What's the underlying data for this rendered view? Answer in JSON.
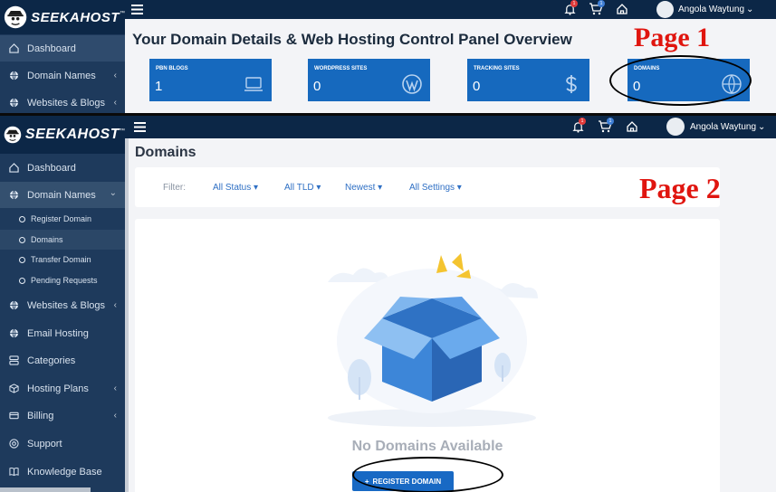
{
  "brand": {
    "name": "SEEKAHOST",
    "tm": "™"
  },
  "page1": {
    "annotation": "Page 1",
    "title": "Your Domain Details & Web Hosting Control Panel Overview",
    "sidebar": [
      {
        "label": "Dashboard",
        "icon": "dashboard-icon"
      },
      {
        "label": "Domain Names",
        "icon": "globe-icon",
        "arrow": "‹"
      },
      {
        "label": "Websites & Blogs",
        "icon": "globe-icon",
        "arrow": "‹"
      }
    ],
    "topbar": {
      "notif_count": "1",
      "cart_count": "1",
      "user": "Angola Waytung",
      "caret": "⌄"
    },
    "stats": [
      {
        "label": "PBN BLOGS",
        "value": "1",
        "icon": "laptop-icon"
      },
      {
        "label": "WORDPRESS SITES",
        "value": "0",
        "icon": "wordpress-icon"
      },
      {
        "label": "TRACKING SITES",
        "value": "0",
        "icon": "dollar-icon"
      },
      {
        "label": "DOMAINS",
        "value": "0",
        "icon": "globe-icon"
      }
    ]
  },
  "page2": {
    "annotation": "Page 2",
    "page_title": "Domains",
    "topbar": {
      "notif_count": "1",
      "cart_count": "1",
      "user": "Angola Waytung",
      "caret": "⌄"
    },
    "sidebar": {
      "dashboard": "Dashboard",
      "domain_names": "Domain Names",
      "domain_names_arrow": "⌄",
      "sub": [
        "Register Domain",
        "Domains",
        "Transfer Domain",
        "Pending Requests"
      ],
      "websites": "Websites & Blogs",
      "email": "Email Hosting",
      "categories": "Categories",
      "hosting": "Hosting Plans",
      "billing": "Billing",
      "support": "Support",
      "kb": "Knowledge Base",
      "arrow": "‹"
    },
    "filter": {
      "label": "Filter:",
      "status": "All Status ▾",
      "tld": "All TLD ▾",
      "sort": "Newest ▾",
      "settings": "All Settings ▾"
    },
    "empty": {
      "title": "No Domains Available",
      "button": "REGISTER DOMAIN",
      "button_icon": "+"
    }
  },
  "colors": {
    "accent": "#1669be",
    "sidebar": "#1e3a5c",
    "topbar": "#0c2747",
    "annotation": "#e0150f"
  }
}
